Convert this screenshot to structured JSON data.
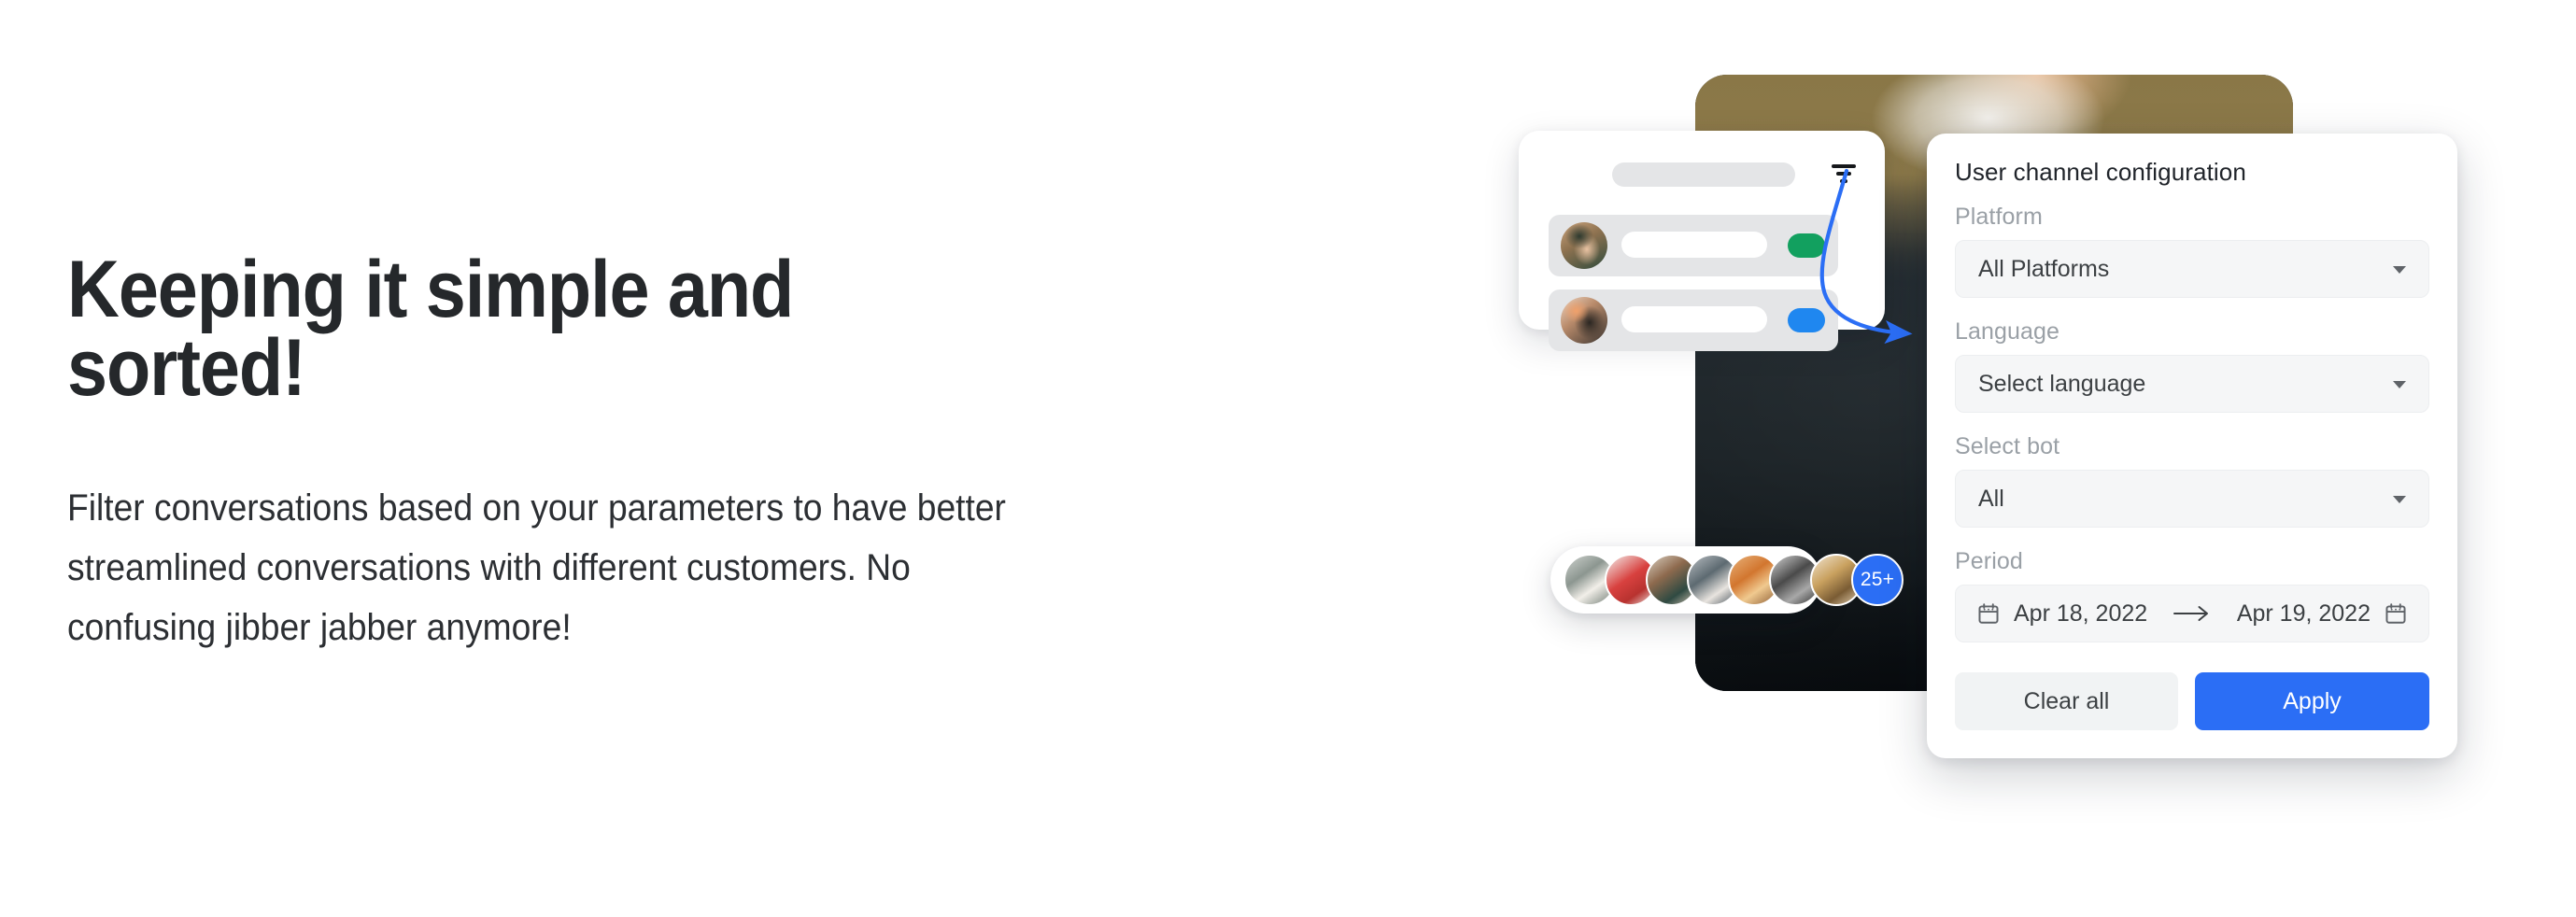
{
  "hero": {
    "headline": "Keeping it simple and sorted!",
    "body": "Filter conversations based on your parameters to have better streamlined conversations with different customers. No confusing jibber jabber anymore!"
  },
  "mockup": {
    "conversation_card": {
      "filter_icon": "filter-icon",
      "rows": [
        {
          "status_color": "#12a05f"
        },
        {
          "status_color": "#1f87f0"
        }
      ]
    },
    "avatar_stack": {
      "overflow_badge": "25+",
      "badge_color": "#2b6ef5",
      "avatar_count": 7
    },
    "status_dot_color": "#1e9e62",
    "connector_color": "#2b6ef5"
  },
  "filter_panel": {
    "title": "User channel configuration",
    "fields": [
      {
        "label": "Platform",
        "value": "All Platforms"
      },
      {
        "label": "Language",
        "value": "Select language"
      },
      {
        "label": "Select bot",
        "value": "All"
      }
    ],
    "period": {
      "label": "Period",
      "start": "Apr 18, 2022",
      "end": "Apr 19, 2022",
      "separator_icon": "arrow-right-icon"
    },
    "actions": {
      "clear": "Clear all",
      "apply": "Apply"
    }
  }
}
